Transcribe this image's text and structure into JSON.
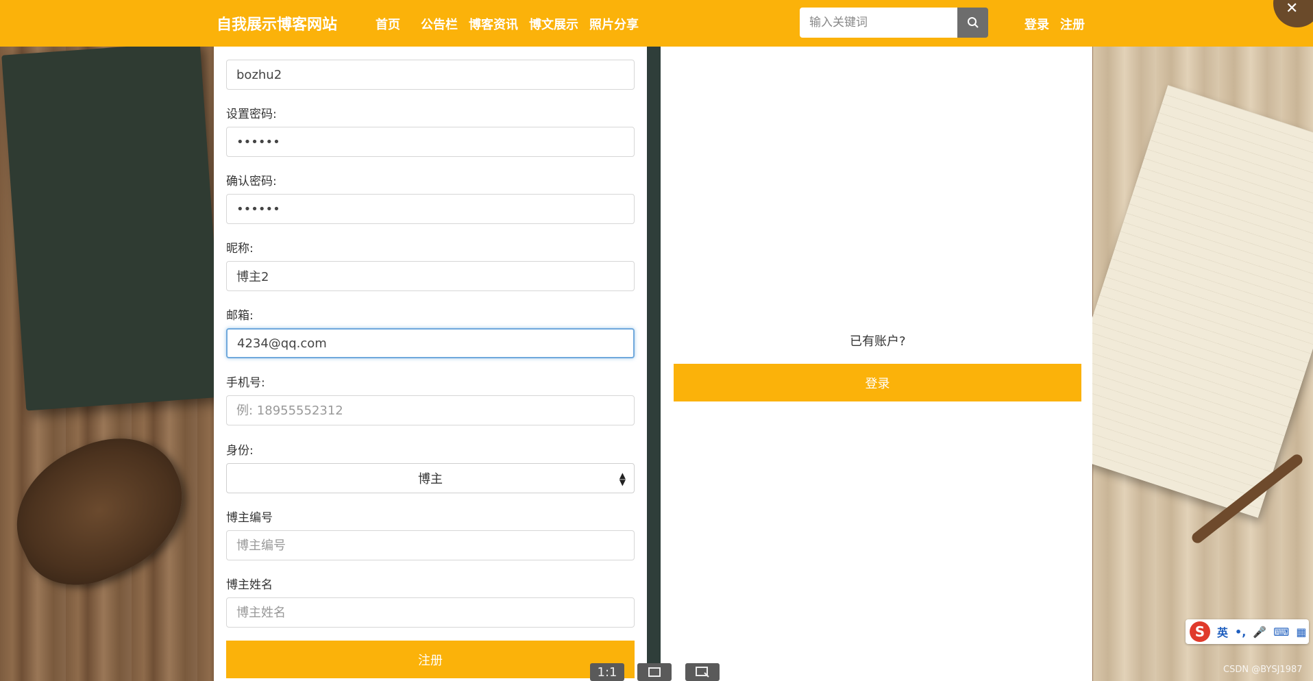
{
  "header": {
    "brand": "自我展示博客网站",
    "nav": [
      "首页",
      "公告栏",
      "博客资讯",
      "博文展示",
      "照片分享"
    ],
    "search_placeholder": "输入关键词",
    "login": "登录",
    "register": "注册"
  },
  "form": {
    "account_value": "bozhu2",
    "password_label": "设置密码:",
    "password_value": "••••••",
    "confirm_label": "确认密码:",
    "confirm_value": "••••••",
    "nickname_label": "昵称:",
    "nickname_value": "博主2",
    "email_label": "邮箱:",
    "email_value": "4234@qq.com",
    "phone_label": "手机号:",
    "phone_placeholder": "例: 18955552312",
    "role_label": "身份:",
    "role_value": "博主",
    "blogger_id_label": "博主编号",
    "blogger_id_placeholder": "博主编号",
    "blogger_name_label": "博主姓名",
    "blogger_name_placeholder": "博主姓名",
    "submit": "注册"
  },
  "right": {
    "has_account": "已有账户?",
    "login_button": "登录"
  },
  "viewer": {
    "one_to_one": "1:1"
  },
  "ime": {
    "logo": "S",
    "lang": "英"
  },
  "watermark": "CSDN @BYSJ1987"
}
